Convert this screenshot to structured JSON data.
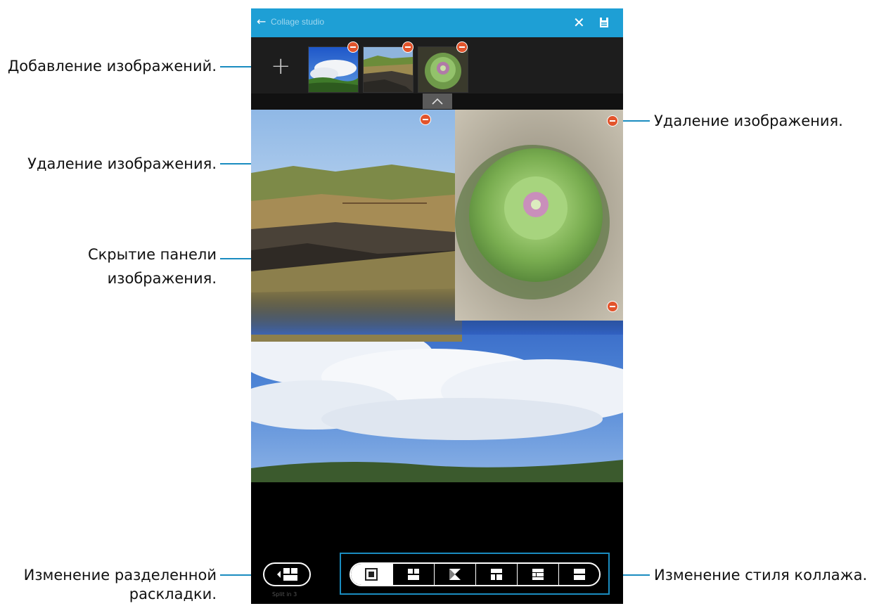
{
  "annotations": {
    "add_images": "Добавление изображений.",
    "delete_image_top": "Удаление изображения.",
    "delete_image_right": "Удаление изображения.",
    "hide_panel_line1": "Скрытие панели",
    "hide_panel_line2": "изображения.",
    "split_line1": "Изменение разделенной",
    "split_line2": "раскладки.",
    "collage_style": "Изменение стиля коллажа."
  },
  "app": {
    "title": "Collage studio",
    "back_icon": "arrow-back-icon",
    "close_icon": "close-icon",
    "save_icon": "save-icon"
  },
  "thumbnails": [
    {
      "name": "sky-field-thumbnail"
    },
    {
      "name": "cliff-thumbnail"
    },
    {
      "name": "cabbage-flower-thumbnail"
    }
  ],
  "bottom": {
    "split_label": "Split in 3",
    "styles": [
      "style-1",
      "style-2",
      "style-3",
      "style-4",
      "style-5",
      "style-6"
    ]
  },
  "colors": {
    "accent": "#1e9fd5",
    "callout_line": "#1a8cc0",
    "delete_badge": "#e2542c"
  }
}
